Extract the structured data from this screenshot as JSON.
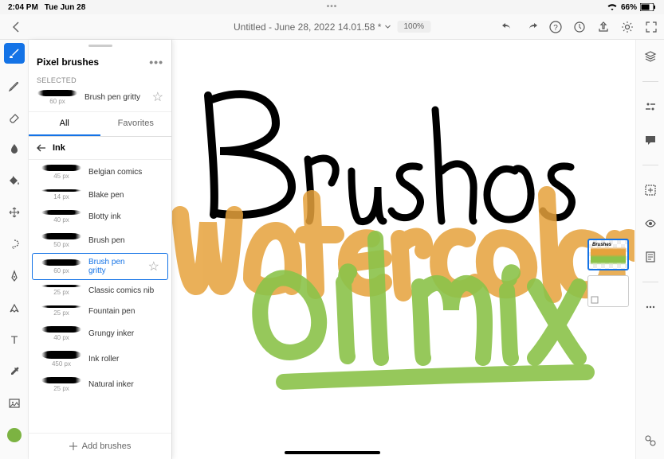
{
  "status": {
    "time": "2:04 PM",
    "date": "Tue Jun 28",
    "battery": "66%"
  },
  "doc": {
    "title": "Untitled - June 28, 2022 14.01.58 *",
    "zoom": "100%"
  },
  "panel": {
    "title": "Pixel brushes",
    "selected_label": "SELECTED",
    "selected": {
      "name": "Brush pen gritty",
      "size": "60 px"
    },
    "tabs": {
      "all": "All",
      "fav": "Favorites"
    },
    "category": "Ink",
    "brushes": [
      {
        "name": "Belgian comics",
        "size": "45 px"
      },
      {
        "name": "Blake pen",
        "size": "14 px"
      },
      {
        "name": "Blotty ink",
        "size": "40 px"
      },
      {
        "name": "Brush pen",
        "size": "50 px"
      },
      {
        "name": "Brush pen gritty",
        "size": "60 px"
      },
      {
        "name": "Classic comics nib",
        "size": "25 px"
      },
      {
        "name": "Fountain pen",
        "size": "25 px"
      },
      {
        "name": "Grungy inker",
        "size": "40 px"
      },
      {
        "name": "Ink roller",
        "size": "450 px"
      },
      {
        "name": "Natural inker",
        "size": "25 px"
      }
    ],
    "add": "Add brushes"
  },
  "canvas": {
    "word1": "Brushes",
    "word2": "Watercolor",
    "word3": "Oil mix"
  }
}
